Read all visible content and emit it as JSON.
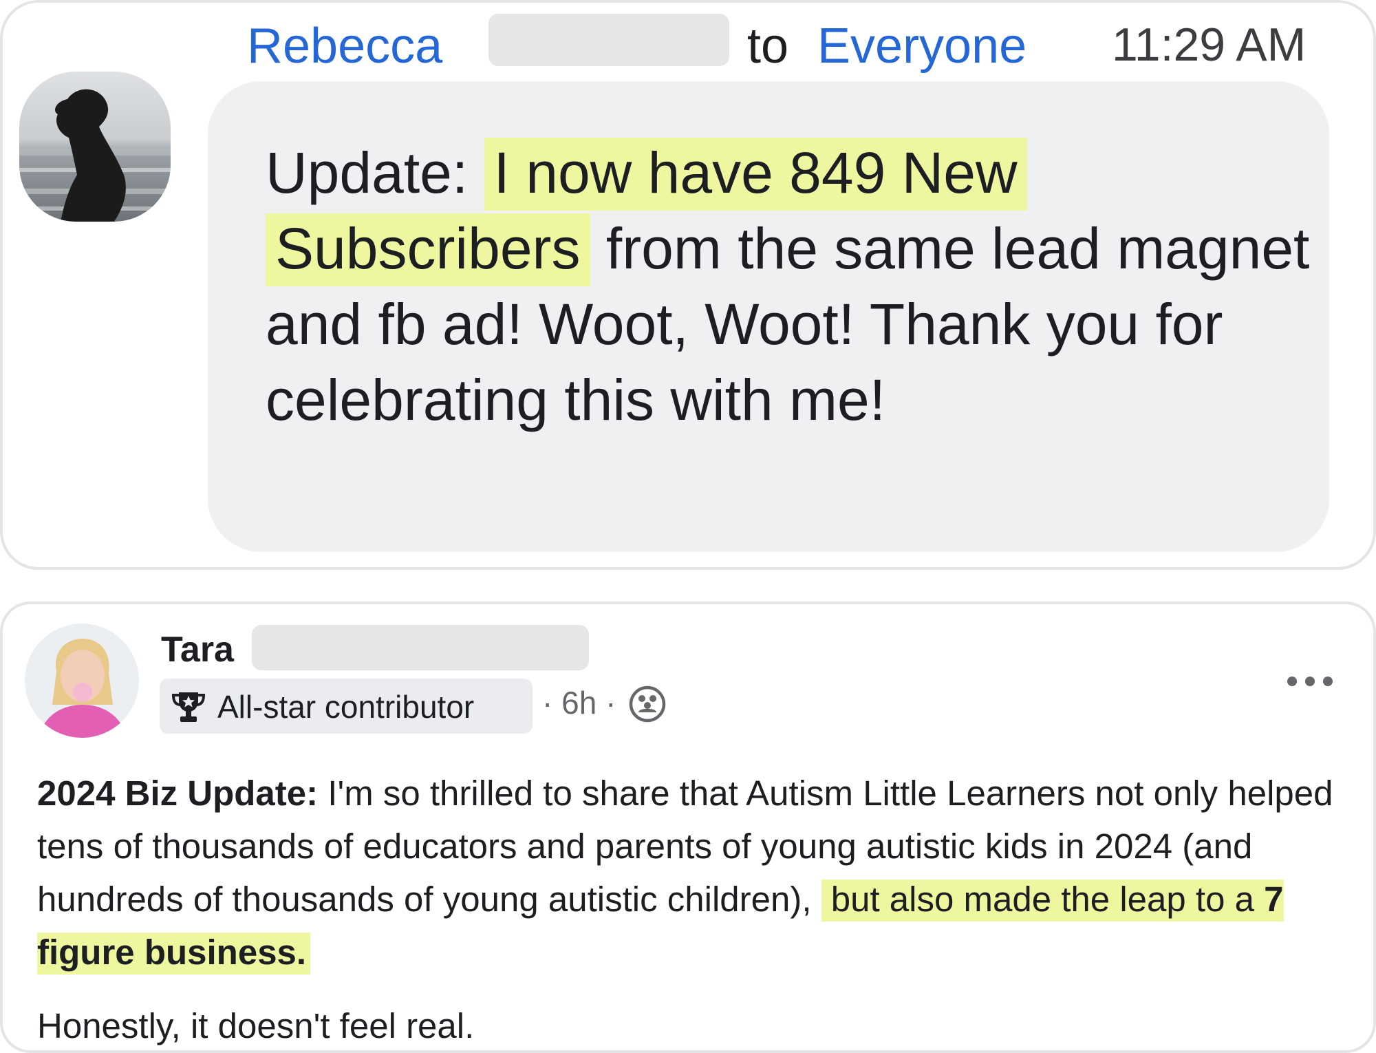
{
  "chat": {
    "sender_name": "Rebecca",
    "to_word": "to",
    "recipient": "Everyone",
    "time": "11:29 AM",
    "message": {
      "prefix": "Update: ",
      "highlight": "I now have 849 New Subscribers",
      "rest": " from the same lead magnet and fb ad!  Woot, Woot! Thank you for celebrating this with me!"
    }
  },
  "post": {
    "author_name": "Tara",
    "badge_label": "All-star contributor",
    "meta_time": "6h",
    "meta_sep": "·",
    "body": {
      "bold_lead": "2024 Biz Update:",
      "text": " I'm so thrilled to share that Autism Little Learners not only helped tens of thousands of educators and parents of young autistic kids in 2024 (and hundreds of thousands of young autistic children), ",
      "highlight_plain": "but also made the leap to a ",
      "highlight_bold": "7 figure business."
    },
    "second_paragraph": "Honestly, it doesn't feel real."
  },
  "colors": {
    "link_blue": "#2567d6",
    "highlight": "#eef79f",
    "bubble_bg": "#f0f0f2",
    "meta_gray": "#65676b"
  },
  "icons": [
    "trophy-icon",
    "group-icon",
    "more-options-icon"
  ]
}
